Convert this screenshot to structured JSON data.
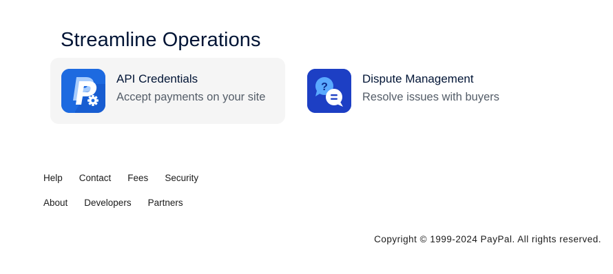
{
  "section": {
    "title": "Streamline Operations"
  },
  "cards": [
    {
      "title": "API Credentials",
      "subtitle": "Accept payments on your site",
      "icon": "paypal-gear-icon",
      "color": "#1d6ae0"
    },
    {
      "title": "Dispute Management",
      "subtitle": "Resolve issues with buyers",
      "icon": "chat-question-icon",
      "color": "#1d3fc4"
    }
  ],
  "footer": {
    "row1": [
      "Help",
      "Contact",
      "Fees",
      "Security"
    ],
    "row2": [
      "About",
      "Developers",
      "Partners"
    ],
    "copyright": "Copyright © 1999-2024 PayPal. All rights reserved."
  }
}
